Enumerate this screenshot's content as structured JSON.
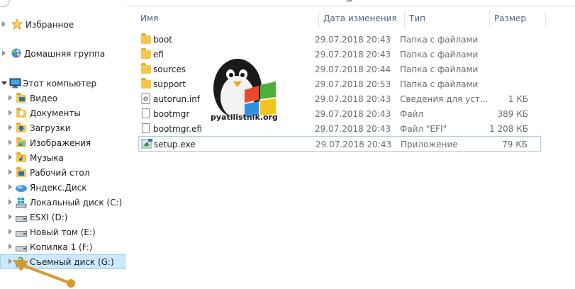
{
  "window": {
    "address_fragment": "· · · · · · ·  ·  ·  ·  ·  ·  ·  ·  ·  ·  ·  ·  ·  ·  ·  · ◢ · ·  ·  ·  ·"
  },
  "sidebar": {
    "favorites": "Избранное",
    "homegroup": "Домашняя группа",
    "this_pc": "Этот компьютер",
    "items": [
      {
        "label": "Видео",
        "icon": "video-folder-icon"
      },
      {
        "label": "Документы",
        "icon": "documents-folder-icon"
      },
      {
        "label": "Загрузки",
        "icon": "downloads-folder-icon"
      },
      {
        "label": "Изображения",
        "icon": "pictures-folder-icon"
      },
      {
        "label": "Музыка",
        "icon": "music-folder-icon"
      },
      {
        "label": "Рабочий стол",
        "icon": "desktop-folder-icon"
      },
      {
        "label": "Яндекс.Диск",
        "icon": "yandex-disk-icon"
      },
      {
        "label": "Локальный диск (C:)",
        "icon": "windows-drive-icon"
      },
      {
        "label": "ESXI (D:)",
        "icon": "drive-icon"
      },
      {
        "label": "Новый том (E:)",
        "icon": "drive-icon"
      },
      {
        "label": "Копилка 1 (F:)",
        "icon": "drive-icon"
      },
      {
        "label": "Съемный диск (G:)",
        "icon": "removable-drive-icon"
      }
    ]
  },
  "columns": {
    "name": "Имя",
    "date": "Дата изменения",
    "type": "Тип",
    "size": "Размер"
  },
  "files": [
    {
      "name": "boot",
      "date": "29.07.2018 20:43",
      "type": "Папка с файлами",
      "size": "",
      "icon": "folder-icon"
    },
    {
      "name": "efi",
      "date": "29.07.2018 20:43",
      "type": "Папка с файлами",
      "size": "",
      "icon": "folder-icon"
    },
    {
      "name": "sources",
      "date": "29.07.2018 20:44",
      "type": "Папка с файлами",
      "size": "",
      "icon": "folder-icon"
    },
    {
      "name": "support",
      "date": "29.07.2018 20:53",
      "type": "Папка с файлами",
      "size": "",
      "icon": "folder-icon"
    },
    {
      "name": "autorun.inf",
      "date": "29.07.2018 20:43",
      "type": "Сведения для уст...",
      "size": "1 КБ",
      "icon": "settings-file-icon"
    },
    {
      "name": "bootmgr",
      "date": "29.07.2018 20:43",
      "type": "Файл",
      "size": "389 КБ",
      "icon": "file-icon"
    },
    {
      "name": "bootmgr.efi",
      "date": "29.07.2018 20:43",
      "type": "Файл \"EFI\"",
      "size": "1 208 КБ",
      "icon": "file-icon"
    },
    {
      "name": "setup.exe",
      "date": "29.07.2018 20:43",
      "type": "Приложение",
      "size": "79 КБ",
      "icon": "setup-exe-icon"
    }
  ],
  "watermark": "pyatilistnik.org",
  "colors": {
    "selection_bg": "#cce8ff",
    "selection_border": "#99d1ff",
    "header_text": "#4d6082",
    "annotation": "#d99a2b"
  }
}
